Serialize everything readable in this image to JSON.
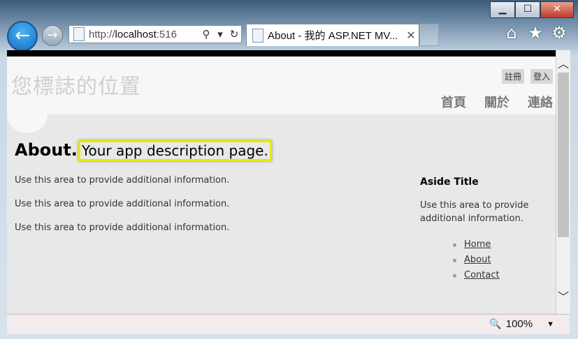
{
  "window": {
    "controls": {
      "minimize": "▁",
      "maximize": "☐",
      "close": "✕"
    }
  },
  "toolbar": {
    "back_glyph": "←",
    "forward_glyph": "→",
    "address_prefix": "http://",
    "address_host": "localhost",
    "address_rest": ":516",
    "search_glyph": "⚲",
    "dropdown_glyph": "▾",
    "refresh_glyph": "↻",
    "tab_title": "About - 我的 ASP.NET MV...",
    "tab_close": "✕",
    "home_glyph": "⌂",
    "favorites_glyph": "★",
    "tools_glyph": "⚙"
  },
  "site": {
    "logo_text": "您標誌的位置",
    "login_links": [
      "註冊",
      "登入"
    ],
    "menu": [
      "首頁",
      "關於",
      "連絡"
    ]
  },
  "page": {
    "title": "About.",
    "subtitle": "Your app description page.",
    "paragraphs": [
      "Use this area to provide additional information.",
      "Use this area to provide additional information.",
      "Use this area to provide additional information."
    ]
  },
  "aside": {
    "title": "Aside Title",
    "text": "Use this area to provide additional information.",
    "links": [
      "Home",
      "About",
      "Contact"
    ]
  },
  "statusbar": {
    "zoom_icon": "🔍",
    "zoom": "100%",
    "zoom_dropdown": "▼"
  },
  "colors": {
    "highlight_border": "#e8e800",
    "page_bg": "#e8e8e8",
    "header_bg": "#f7f7f7"
  }
}
